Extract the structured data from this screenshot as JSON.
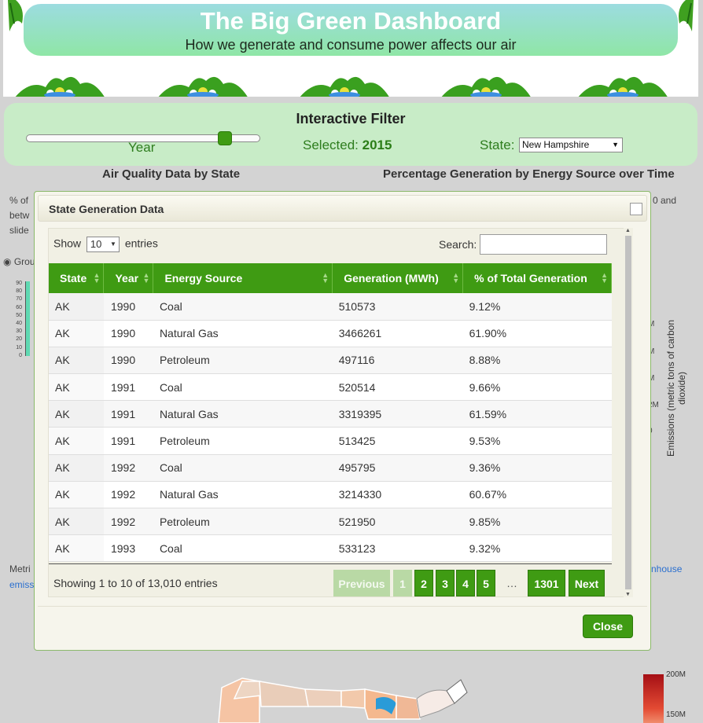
{
  "header": {
    "title": "The Big Green Dashboard",
    "subtitle": "How we generate and consume power affects our air"
  },
  "filter": {
    "title": "Interactive Filter",
    "slider_label": "Year",
    "slider_fraction": 0.87,
    "selected_label": "Selected:",
    "selected_value": "2015",
    "state_label": "State:",
    "state_value": "New Hampshire"
  },
  "sections": {
    "left_heading": "Air Quality Data by State",
    "right_heading": "Percentage Generation by Energy Source over Time"
  },
  "background": {
    "left_text_1": "% of",
    "left_text_2": "betw",
    "left_text_3": "slide",
    "right_text_1": "0 and",
    "radio_label": "Grou",
    "mini_ticks": [
      "90",
      "80",
      "70",
      "60",
      "50",
      "40",
      "30",
      "20",
      "10",
      "0"
    ],
    "right_ticks": [
      "M",
      "M",
      "M",
      "2M",
      "0"
    ],
    "emissions_label": "Emissions (metric tons of carbon dioxide)",
    "bottom_left_1": "Metri",
    "bottom_left_2": "emiss",
    "bottom_right": "nhouse",
    "legend_top": "200M",
    "legend_mid": "150M"
  },
  "modal": {
    "title": "State Generation Data",
    "show_label": "Show",
    "entries_label": "entries",
    "page_length": "10",
    "search_label": "Search:",
    "search_value": "",
    "columns": [
      "State",
      "Year",
      "Energy Source",
      "Generation (MWh)",
      "% of Total Generation"
    ],
    "rows": [
      [
        "AK",
        "1990",
        "Coal",
        "510573",
        "9.12%"
      ],
      [
        "AK",
        "1990",
        "Natural Gas",
        "3466261",
        "61.90%"
      ],
      [
        "AK",
        "1990",
        "Petroleum",
        "497116",
        "8.88%"
      ],
      [
        "AK",
        "1991",
        "Coal",
        "520514",
        "9.66%"
      ],
      [
        "AK",
        "1991",
        "Natural Gas",
        "3319395",
        "61.59%"
      ],
      [
        "AK",
        "1991",
        "Petroleum",
        "513425",
        "9.53%"
      ],
      [
        "AK",
        "1992",
        "Coal",
        "495795",
        "9.36%"
      ],
      [
        "AK",
        "1992",
        "Natural Gas",
        "3214330",
        "60.67%"
      ],
      [
        "AK",
        "1992",
        "Petroleum",
        "521950",
        "9.85%"
      ],
      [
        "AK",
        "1993",
        "Coal",
        "533123",
        "9.32%"
      ]
    ],
    "info": "Showing 1 to 10 of 13,010 entries",
    "pager": {
      "previous": "Previous",
      "pages": [
        "1",
        "2",
        "3",
        "4",
        "5"
      ],
      "ellipsis": "…",
      "last": "1301",
      "next": "Next"
    },
    "close_label": "Close"
  },
  "colors": {
    "accent": "#3f9b13",
    "filter_bg": "#c8ecc7",
    "page_bg": "#d3d3d3"
  }
}
